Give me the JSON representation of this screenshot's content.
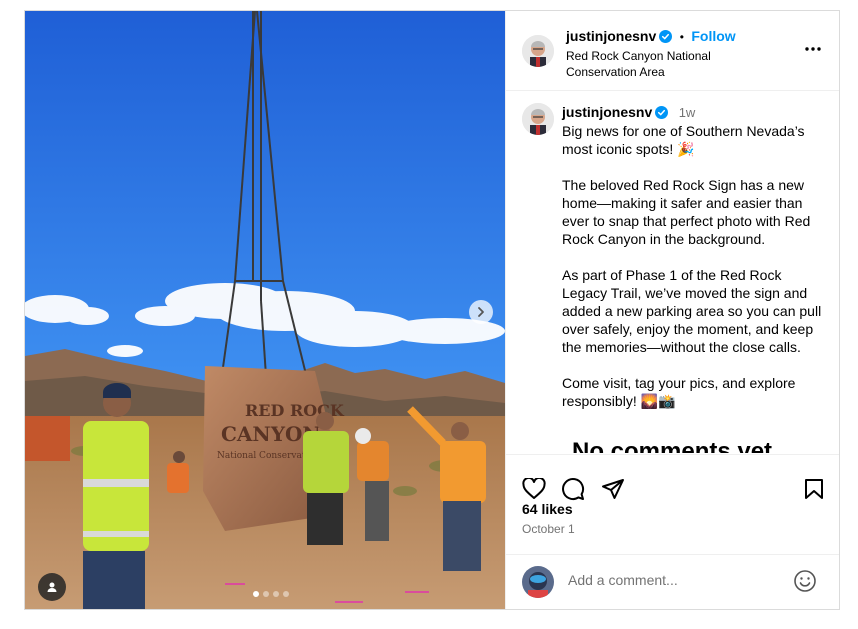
{
  "header": {
    "username": "justinjonesnv",
    "separator": "•",
    "follow_label": "Follow",
    "location_line1": "Red Rock Canyon National",
    "location_line2": "Conservation Area"
  },
  "caption": {
    "username": "justinjonesnv",
    "time_ago": "1w",
    "paragraphs": [
      "Big news for one of Southern Nevada’s most iconic spots! 🎉",
      "The beloved Red Rock Sign has a new home—making it safer and easier than ever to snap that perfect photo with Red Rock Canyon in the background.",
      "As part of Phase 1 of the Red Rock Legacy Trail, we’ve moved the sign and added a new parking area so you can pull over safely, enjoy the moment, and keep the memories—without the close calls.",
      "Come visit, tag your pics, and explore responsibly! 🌄📸"
    ],
    "no_comments": "No comments yet"
  },
  "photo": {
    "sign_line1": "RED ROCK",
    "sign_line2": "CANYON",
    "sign_line3": "National Conservation Area"
  },
  "actions": {
    "likes": "64 likes",
    "date": "October 1"
  },
  "comment": {
    "placeholder": "Add a comment..."
  },
  "colors": {
    "accent": "#0095f6",
    "verified": "#0095f6",
    "muted": "#737373",
    "border": "#dbdbdb"
  },
  "icons": [
    "verified-badge-icon",
    "more-options-icon",
    "next-arrow-icon",
    "tag-person-icon",
    "heart-icon",
    "comment-icon",
    "share-icon",
    "bookmark-icon",
    "emoji-icon"
  ]
}
